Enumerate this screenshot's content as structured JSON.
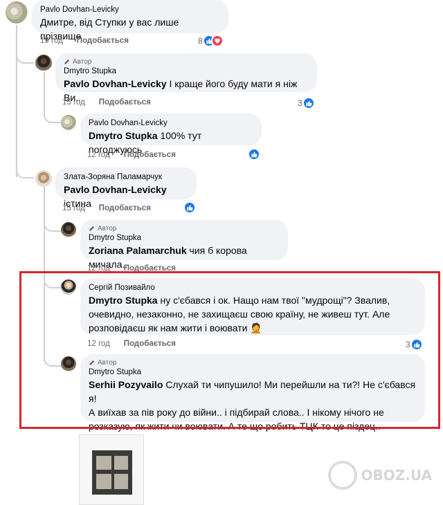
{
  "comments": [
    {
      "author": "Pavlo Dovhan-Levicky",
      "text": "Дмитре, від Ступки у вас лише прізвище",
      "time": "19 год",
      "like_label": "Подобається",
      "reaction_count": "8"
    },
    {
      "badge": "Автор",
      "author": "Dmytro Stupka",
      "mention": "Pavlo Dovhan-Levicky",
      "text": " І краще його буду мати я ніж Ви..",
      "time": "15 год",
      "like_label": "Подобається",
      "reaction_count": "3"
    },
    {
      "author": "Pavlo Dovhan-Levicky",
      "mention": "Dmytro Stupka",
      "text": " 100% тут погоджуюсь",
      "time": "12 год",
      "like_label": "Подобається"
    },
    {
      "author": "Злата-Зоряна Паламарчук",
      "mention": "Pavlo Dovhan-Levicky",
      "text": " істина",
      "time": "15 год",
      "like_label": "Подобається"
    },
    {
      "badge": "Автор",
      "author": "Dmytro Stupka",
      "mention": "Zoriana Palamarchuk",
      "text": " чия б корова мичала..",
      "time": "12 год",
      "like_label": "Подобається"
    },
    {
      "author": "Сергій Позивайло",
      "mention": "Dmytro Stupka",
      "text_line1": " ну с'єбався і ок. Нащо нам твої \"мудрощі\"? Звалив,",
      "text_line2": "очевидно, незаконно, не захищаєш свою країну, не живеш тут. Але",
      "text_line3": "розповідаєш як нам жити і воювати 🤦",
      "time": "12 год",
      "like_label": "Подобається",
      "reaction_count": "3"
    },
    {
      "badge": "Автор",
      "author": "Dmytro Stupka",
      "mention": "Serhii Pozyvailo",
      "text_line1": " Слухай ти чипушило! Ми перейшли на ти?! Не с'єбався я!",
      "text_line2": "А виїхав за пів року до війни.. і підбирай слова.. І нікому нічого не",
      "text_line3": "розказую, як жити чи воювати. А те що робить ТЦК то це піздец.."
    }
  ],
  "watermark": "OBOZ.UA",
  "colors": {
    "accent": "#1877f2",
    "highlight": "#d7262e",
    "bubble": "#f0f2f5"
  }
}
